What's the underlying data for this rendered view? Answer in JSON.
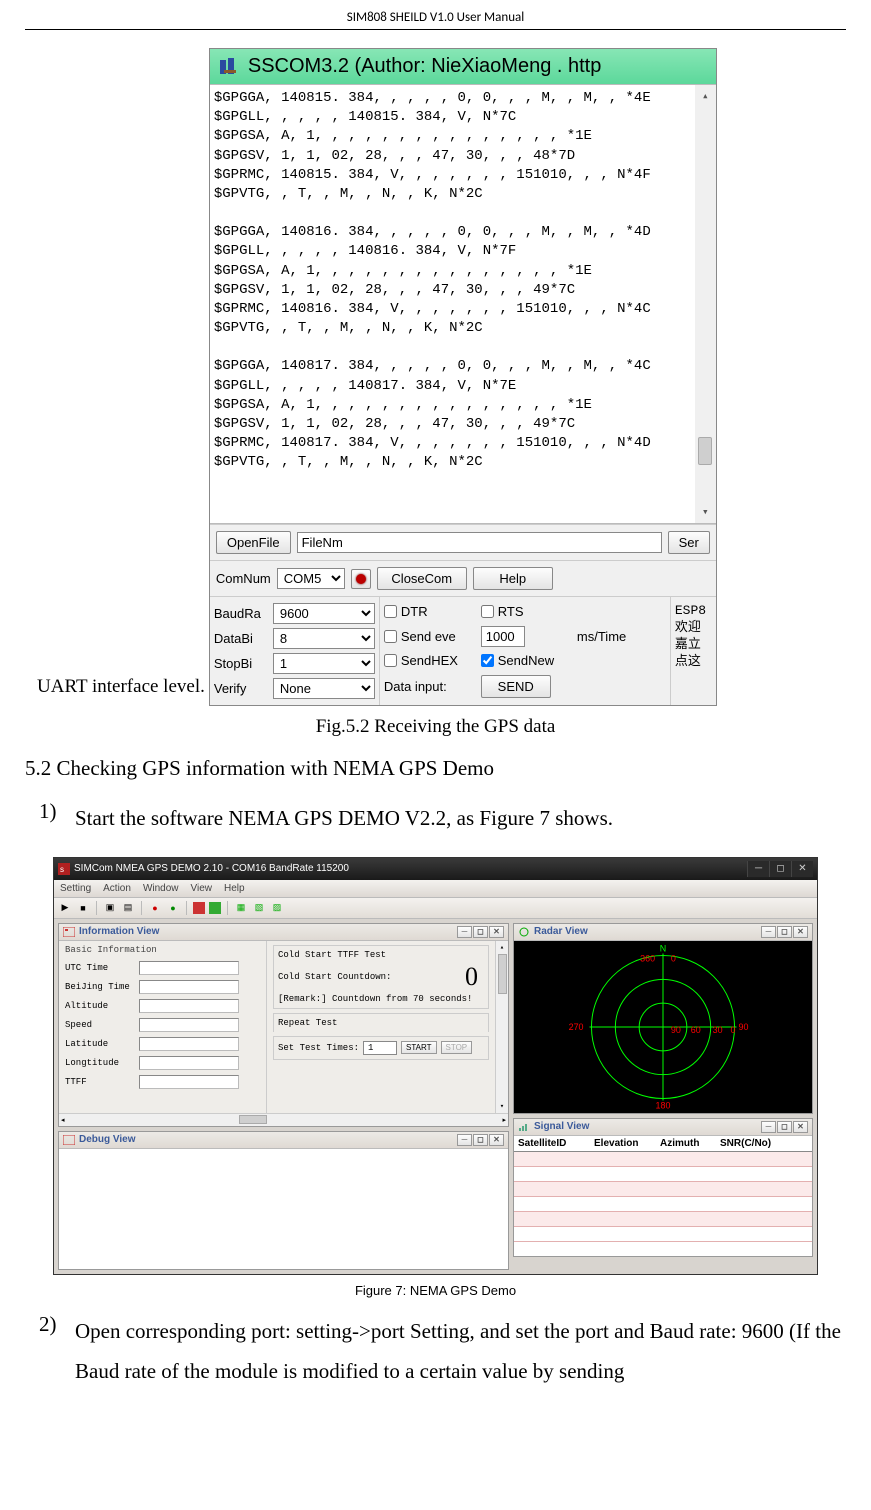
{
  "doc": {
    "header": "SIM808 SHEILD V1.0 User Manual",
    "uart_label": "UART interface level.",
    "fig52": "Fig.5.2 Receiving the GPS data",
    "section52": "5.2 Checking GPS information with NEMA GPS Demo",
    "step1_num": "1)",
    "step1_txt": "Start the software NEMA GPS DEMO V2.2, as Figure 7 shows.",
    "fig7": "Figure 7: NEMA GPS Demo",
    "step2_num": "2)",
    "step2_txt": "Open corresponding port: setting->port Setting, and set the port and Baud rate: 9600 (If the Baud rate of the module is modified to a certain value by sending"
  },
  "sscom": {
    "title": "SSCOM3.2 (Author: NieXiaoMeng .  http",
    "lines": "$GPGGA, 140815. 384, , , , , 0, 0, , , M, , M, , *4E\n$GPGLL, , , , , 140815. 384, V, N*7C\n$GPGSA, A, 1, , , , , , , , , , , , , , , *1E\n$GPGSV, 1, 1, 02, 28, , , 47, 30, , , 48*7D\n$GPRMC, 140815. 384, V, , , , , , , 151010, , , N*4F\n$GPVTG, , T, , M, , N, , K, N*2C\n\n$GPGGA, 140816. 384, , , , , 0, 0, , , M, , M, , *4D\n$GPGLL, , , , , 140816. 384, V, N*7F\n$GPGSA, A, 1, , , , , , , , , , , , , , , *1E\n$GPGSV, 1, 1, 02, 28, , , 47, 30, , , 49*7C\n$GPRMC, 140816. 384, V, , , , , , , 151010, , , N*4C\n$GPVTG, , T, , M, , N, , K, N*2C\n\n$GPGGA, 140817. 384, , , , , 0, 0, , , M, , M, , *4C\n$GPGLL, , , , , 140817. 384, V, N*7E\n$GPGSA, A, 1, , , , , , , , , , , , , , , *1E\n$GPGSV, 1, 1, 02, 28, , , 47, 30, , , 49*7C\n$GPRMC, 140817. 384, V, , , , , , , 151010, , , N*4D\n$GPVTG, , T, , M, , N, , K, N*2C",
    "openfile_btn": "OpenFile",
    "filenm": "FileNm",
    "ser_btn": "Ser",
    "comnum_label": "ComNum",
    "comnum_value": "COM5",
    "closecom_btn": "CloseCom",
    "help_btn": "Help",
    "baud_label": "BaudRa",
    "baud_value": "9600",
    "databi_label": "DataBi",
    "databi_value": "8",
    "stopbi_label": "StopBi",
    "stopbi_value": "1",
    "verify_label": "Verify",
    "verify_value": "None",
    "dtr": "DTR",
    "rts": "RTS",
    "sendeve": "Send eve",
    "ms_val": "1000",
    "ms_label": "ms/Time",
    "sendhex": "SendHEX",
    "sendnew": "SendNew",
    "datainput": "Data input:",
    "send_btn": "SEND",
    "cn1": "ESP8",
    "cn2": "欢迎",
    "cn3": "嘉立",
    "cn4": "点这"
  },
  "nema": {
    "title": "SIMCom NMEA GPS DEMO 2.10 - COM16 BandRate 115200",
    "menu": {
      "setting": "Setting",
      "action": "Action",
      "window": "Window",
      "view": "View",
      "help": "Help"
    },
    "info": {
      "title": "Information View",
      "basic": "Basic Information",
      "utc": "UTC Time",
      "bj": "BeiJing Time",
      "alt": "Altitude",
      "spd": "Speed",
      "lat": "Latitude",
      "lon": "Longtitude",
      "ttff": "TTFF",
      "cold_title": "Cold Start TTFF Test",
      "cold_cd": "Cold Start Countdown:",
      "big0": "0",
      "remark": "[Remark:] Countdown from 70 seconds!",
      "repeat": "Repeat Test",
      "settimes": "Set Test Times:",
      "settimes_val": "1",
      "start": "START",
      "stop": "STOP"
    },
    "radar": {
      "title": "Radar View",
      "n": "N",
      "t0": "0",
      "t30": "30",
      "t60": "60",
      "t90l": "90",
      "t90r": "90",
      "t180": "180",
      "t270": "270",
      "t360": "360"
    },
    "debug": {
      "title": "Debug View"
    },
    "signal": {
      "title": "Signal View",
      "h1": "SatelliteID",
      "h2": "Elevation",
      "h3": "Azimuth",
      "h4": "SNR(C/No)"
    }
  }
}
